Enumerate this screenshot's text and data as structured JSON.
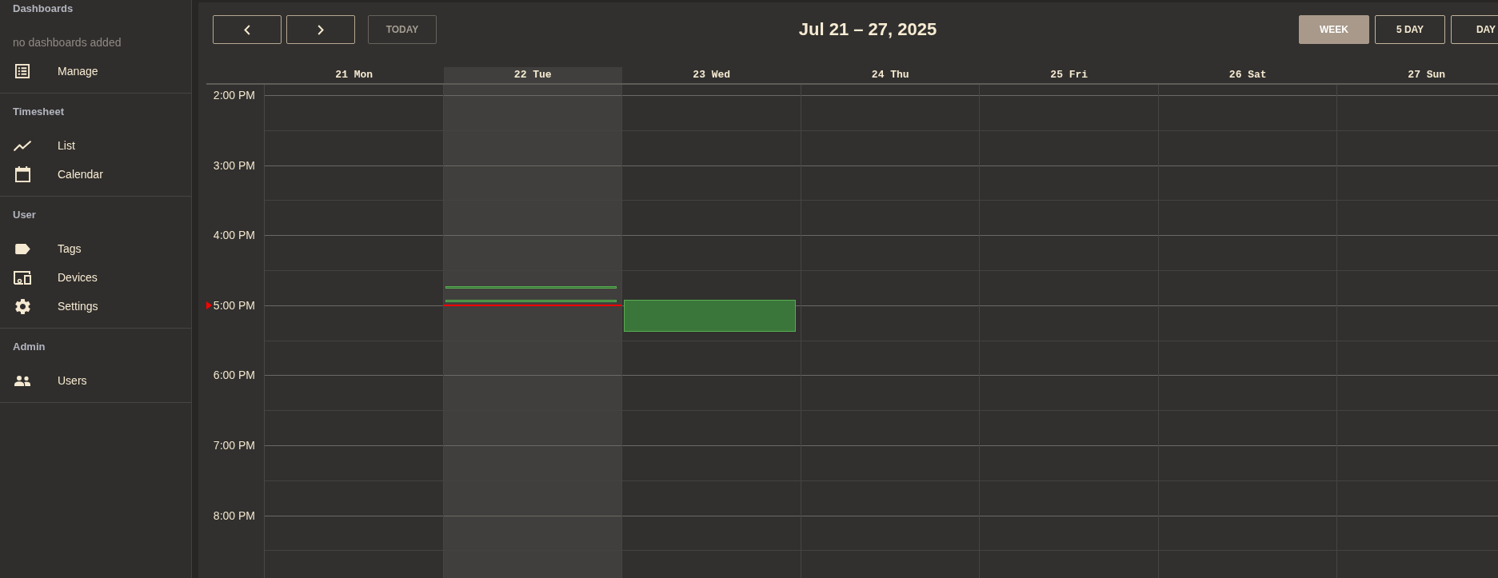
{
  "sidebar": {
    "groups": [
      {
        "title": "Dashboards",
        "empty_text": "no dashboards added",
        "items": [
          {
            "label": "Manage"
          }
        ]
      },
      {
        "title": "Timesheet",
        "items": [
          {
            "label": "List"
          },
          {
            "label": "Calendar"
          }
        ]
      },
      {
        "title": "User",
        "items": [
          {
            "label": "Tags"
          },
          {
            "label": "Devices"
          },
          {
            "label": "Settings"
          }
        ]
      },
      {
        "title": "Admin",
        "items": [
          {
            "label": "Users"
          }
        ]
      }
    ]
  },
  "toolbar": {
    "today_button": {
      "label": "TODAY",
      "disabled": true
    },
    "title": "Jul 21 – 27, 2025",
    "views": [
      {
        "label": "WEEK",
        "selected": true
      },
      {
        "label": "5 DAY",
        "selected": false
      },
      {
        "label": "DAY",
        "selected": false
      }
    ]
  },
  "calendar": {
    "days": [
      {
        "label": "21 Mon",
        "today": false
      },
      {
        "label": "22 Tue",
        "today": true,
        "events": [
          {
            "kind": "line"
          },
          {
            "kind": "line"
          }
        ]
      },
      {
        "label": "23 Wed",
        "today": false,
        "events": [
          {
            "kind": "block"
          }
        ]
      },
      {
        "label": "24 Thu",
        "today": false
      },
      {
        "label": "25 Fri",
        "today": false
      },
      {
        "label": "26 Sat",
        "today": false
      },
      {
        "label": "27 Sun",
        "today": false
      }
    ],
    "hours": [
      {
        "label": "2:00 PM",
        "current": false
      },
      {
        "label": "3:00 PM",
        "current": false
      },
      {
        "label": "4:00 PM",
        "current": false
      },
      {
        "label": "5:00 PM",
        "current": true
      },
      {
        "label": "6:00 PM",
        "current": false
      },
      {
        "label": "7:00 PM",
        "current": false
      },
      {
        "label": "8:00 PM",
        "current": false
      }
    ]
  }
}
